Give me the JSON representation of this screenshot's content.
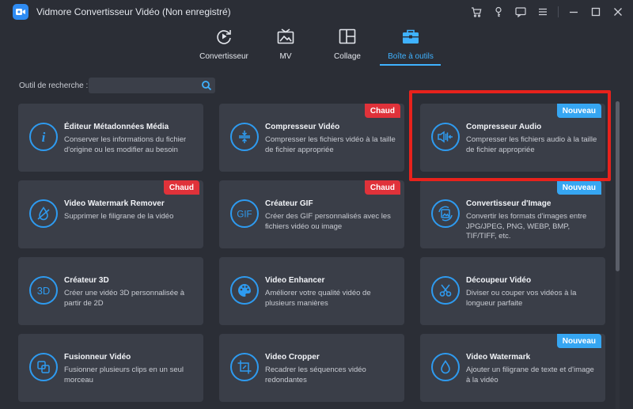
{
  "window": {
    "title": "Vidmore Convertisseur Vidéo (Non enregistré)",
    "titlebar_icons": [
      "cart-icon",
      "key-icon",
      "feedback-icon",
      "menu-icon",
      "minimize-icon",
      "maximize-icon",
      "close-icon"
    ]
  },
  "nav": {
    "items": [
      {
        "label": "Convertisseur",
        "icon": "convert-icon"
      },
      {
        "label": "MV",
        "icon": "mv-icon"
      },
      {
        "label": "Collage",
        "icon": "collage-icon"
      },
      {
        "label": "Boîte à outils",
        "icon": "toolbox-icon"
      }
    ],
    "active": "Boîte à outils"
  },
  "search": {
    "label": "Outil de recherche :",
    "value": "",
    "placeholder": ""
  },
  "tools": [
    {
      "title": "Éditeur Métadonnées Média",
      "desc": "Conserver les informations du fichier d'origine ou les modifier au besoin",
      "icon": "info-icon",
      "badge": ""
    },
    {
      "title": "Compresseur Vidéo",
      "desc": "Compresser les fichiers vidéo à la taille de fichier appropriée",
      "icon": "compress-icon",
      "badge": "Chaud"
    },
    {
      "title": "Compresseur Audio",
      "desc": "Compresser les fichiers audio à la taille de fichier appropriée",
      "icon": "audio-compress-icon",
      "badge": "Nouveau",
      "highlighted": true
    },
    {
      "title": "Video Watermark Remover",
      "desc": "Supprimer le filigrane de la vidéo",
      "icon": "watermark-remove-icon",
      "badge": "Chaud"
    },
    {
      "title": "Créateur GIF",
      "desc": "Créer des GIF personnalisés avec les fichiers vidéo ou image",
      "icon": "gif-icon",
      "badge": "Chaud"
    },
    {
      "title": "Convertisseur d'Image",
      "desc": "Convertir les formats d'images entre JPG/JPEG, PNG, WEBP, BMP, TIF/TIFF, etc.",
      "icon": "image-convert-icon",
      "badge": "Nouveau"
    },
    {
      "title": "Créateur 3D",
      "desc": "Créer une vidéo 3D personnalisée à partir de 2D",
      "icon": "3d-icon",
      "badge": ""
    },
    {
      "title": "Video Enhancer",
      "desc": "Améliorer votre qualité vidéo de plusieurs manières",
      "icon": "palette-icon",
      "badge": ""
    },
    {
      "title": "Découpeur Vidéo",
      "desc": "Diviser ou couper vos vidéos à la longueur parfaite",
      "icon": "scissors-icon",
      "badge": ""
    },
    {
      "title": "Fusionneur Vidéo",
      "desc": "Fusionner plusieurs clips en un seul morceau",
      "icon": "merge-icon",
      "badge": ""
    },
    {
      "title": "Video Cropper",
      "desc": "Recadrer les séquences vidéo redondantes",
      "icon": "crop-icon",
      "badge": ""
    },
    {
      "title": "Video Watermark",
      "desc": "Ajouter un filigrane de texte et d'image à la vidéo",
      "icon": "drop-icon",
      "badge": "Nouveau"
    }
  ],
  "colors": {
    "accent": "#3fb2ff",
    "badge_hot": "#e0323a",
    "badge_new": "#36a6f2",
    "highlight": "#e8221c"
  }
}
